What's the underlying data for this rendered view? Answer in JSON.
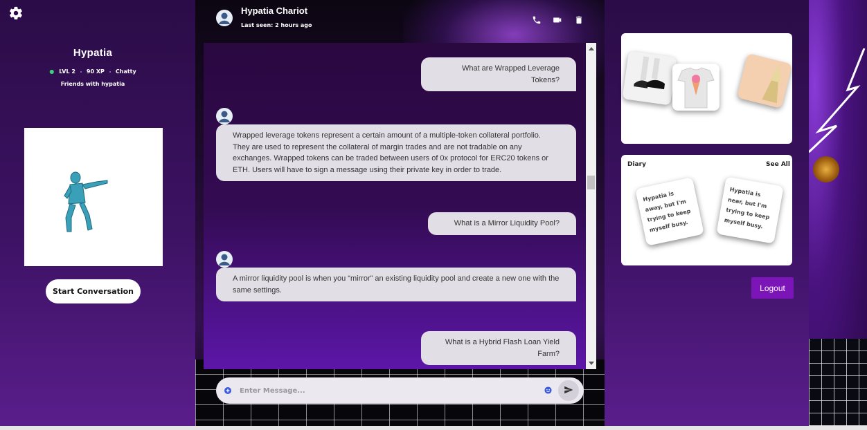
{
  "profile": {
    "name": "Hypatia",
    "level": "LVL 2",
    "xp": "90 XP",
    "mood": "Chatty",
    "friendship": "Friends with hypatia",
    "start_button": "Start Conversation"
  },
  "chat": {
    "contact_name": "Hypatia Chariot",
    "last_seen": "Last seen: 2 hours ago",
    "icons": [
      "phone-icon",
      "video-icon",
      "trash-icon"
    ],
    "messages": [
      {
        "from": "user",
        "text": "What are Wrapped Leverage Tokens?"
      },
      {
        "from": "bot",
        "text": "Wrapped leverage tokens represent a certain amount of a multiple-token collateral portfolio. They are used to represent the collateral of margin trades and are not tradable on any exchanges. Wrapped tokens can be traded between users of 0x protocol for ERC20 tokens or ETH. Users will have to sign a message using their private key in order to trade."
      },
      {
        "from": "user",
        "text": "What is a Mirror Liquidity Pool?"
      },
      {
        "from": "bot",
        "text": "A mirror liquidity pool is when you “mirror” an existing liquidity pool and create a new one with the same settings."
      },
      {
        "from": "user",
        "text": "What is a Hybrid Flash Loan Yield Farm?"
      }
    ],
    "input_placeholder": "Enter Message..."
  },
  "diary": {
    "title": "Diary",
    "see_all": "See All",
    "notes": [
      "Hypatia is away, but I'm trying to keep myself busy.",
      "Hypatia is near, but I'm trying to keep myself busy."
    ]
  },
  "logout_label": "Logout",
  "colors": {
    "accent": "#7b15b8",
    "sidebar": "#3d1264",
    "bubble": "#e2dee6"
  }
}
